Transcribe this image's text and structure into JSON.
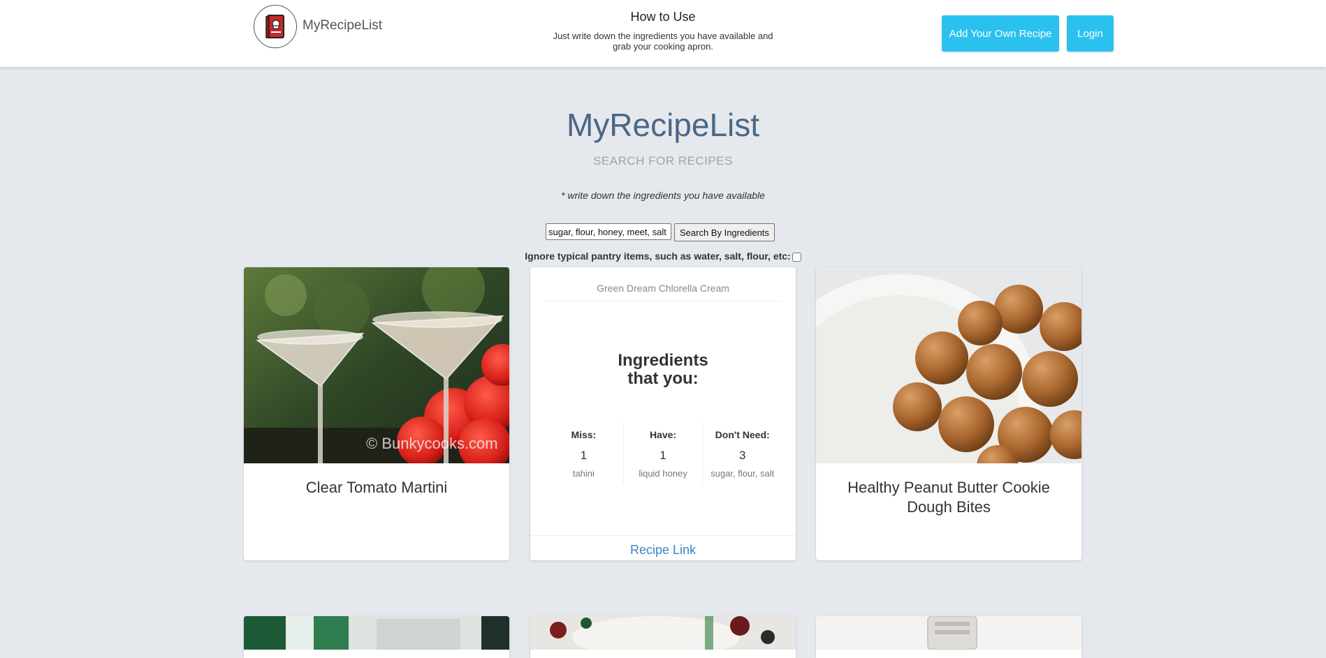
{
  "header": {
    "brand": "MyRecipeList",
    "how_to_title": "How to Use",
    "how_to_text": "Just write down the ingredients you have available and grab your cooking apron.",
    "add_recipe_label": "Add Your Own Recipe",
    "login_label": "Login"
  },
  "hero": {
    "title": "MyRecipeList",
    "subtitle": "SEARCH FOR RECIPES",
    "hint": "* write down the ingredients you have available"
  },
  "search": {
    "value": "sugar, flour, honey, meet, salt",
    "button_label": "Search By Ingredients",
    "pantry_label": "Ignore typical pantry items, such as water, salt, flour, etc:",
    "pantry_checked": false
  },
  "cards": [
    {
      "title": "Clear Tomato Martini",
      "image_watermark": "© Bunkycooks.com"
    },
    {
      "recipe_name": "Green Dream Chlorella Cream",
      "heading_line1": "Ingredients",
      "heading_line2": "that you:",
      "miss_label": "Miss:",
      "miss_count": "1",
      "miss_items": "tahini",
      "have_label": "Have:",
      "have_count": "1",
      "have_items": "liquid honey",
      "dont_need_label": "Don't Need:",
      "dont_need_count": "3",
      "dont_need_items": "sugar, flour, salt",
      "link_label": "Recipe Link"
    },
    {
      "title": "Healthy Peanut Butter Cookie Dough Bites"
    }
  ],
  "colors": {
    "accent": "#2bc1ee",
    "hero_title": "#4a6785",
    "link": "#3a85c6",
    "background": "#e5e8ed"
  }
}
